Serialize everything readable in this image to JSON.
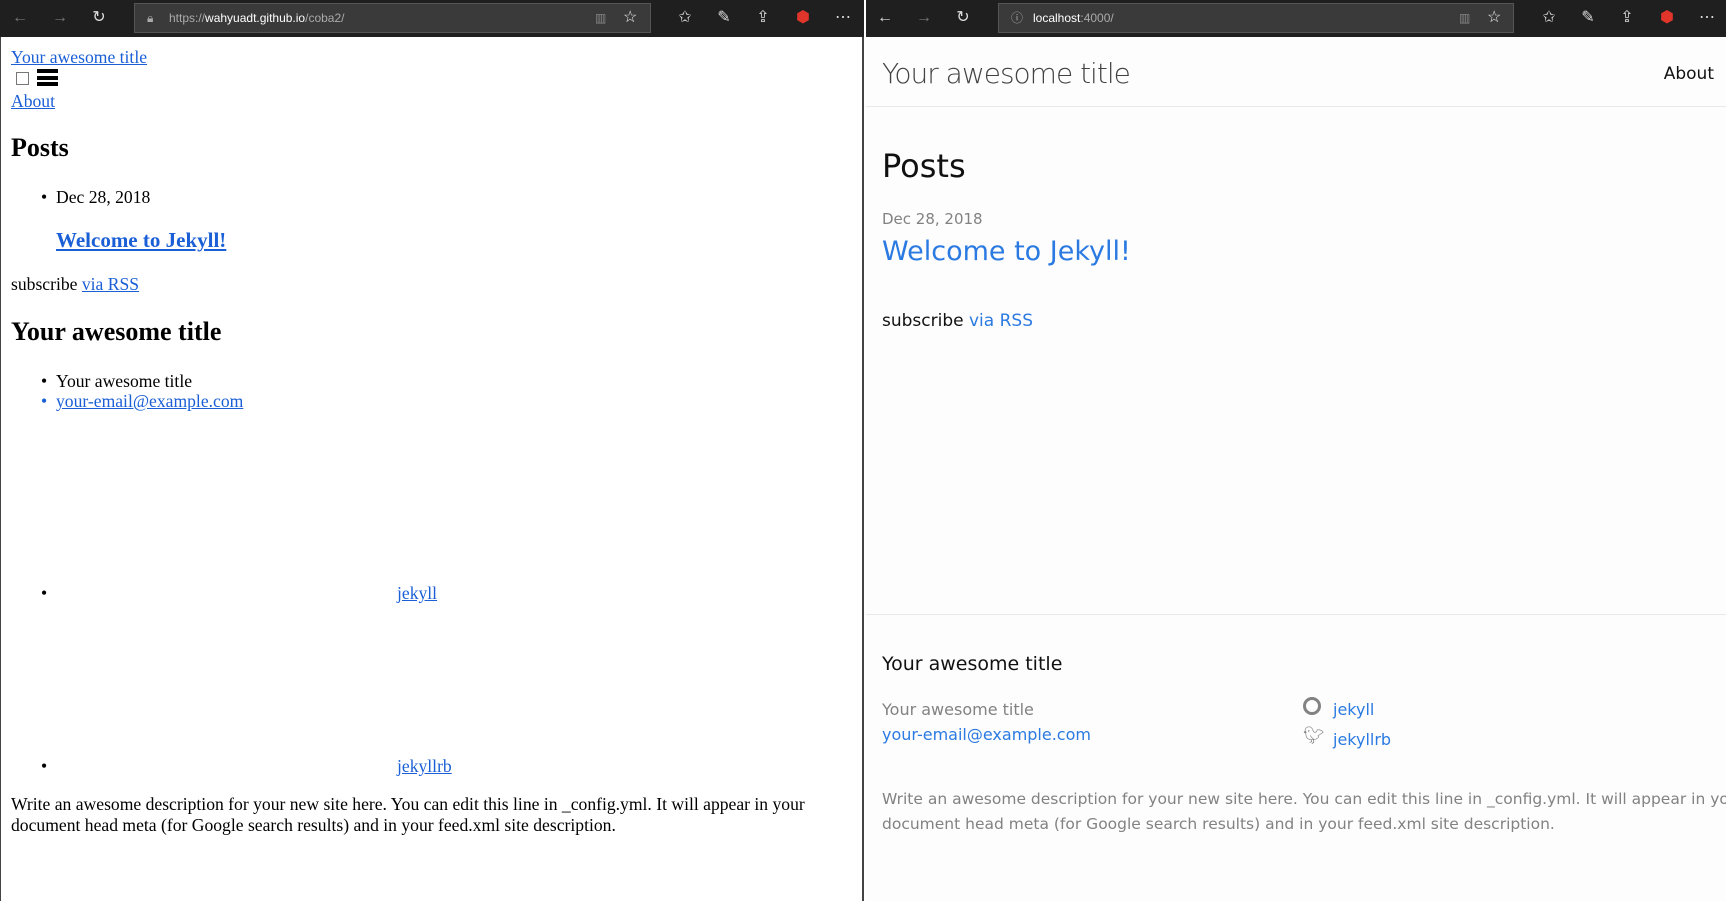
{
  "left_browser": {
    "url_prefix": "https://",
    "url_host": "wahyuadt.github.io",
    "url_path": "/coba2/"
  },
  "right_browser": {
    "url_host": "localhost",
    "url_path": ":4000/"
  },
  "site": {
    "title": "Your awesome title",
    "nav_about": "About",
    "posts_heading": "Posts",
    "post_date": "Dec 28, 2018",
    "post_title": "Welcome to Jekyll!",
    "subscribe": "subscribe",
    "rss_link": "via RSS",
    "footer_heading": "Your awesome title",
    "footer_name": "Your awesome title",
    "footer_email": "your-email@example.com",
    "github_user": "jekyll",
    "twitter_user": "jekyllrb",
    "description_line1": "Write an awesome description for your new site here. You can edit this line in _config.yml. It will appear in your",
    "description_line2": "document head meta (for Google search results) and in your feed.xml site description."
  }
}
